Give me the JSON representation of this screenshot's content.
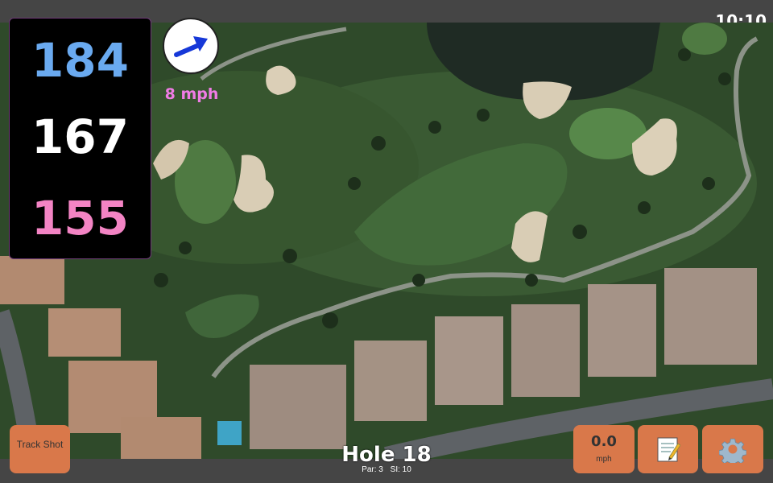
{
  "status": {
    "time": "10:10"
  },
  "distances": {
    "back": "184",
    "middle": "167",
    "front": "155",
    "colors": {
      "back": "#6aaaf0",
      "middle": "#ffffff",
      "front": "#f384c4"
    }
  },
  "wind": {
    "arrow_icon": "wind-direction-arrow-icon",
    "speed_label": "8 mph",
    "speed_color": "#f07ce6"
  },
  "buttons": {
    "track_shot": "Track Shot",
    "wind_value": "0.0",
    "wind_unit": "mph",
    "notes_icon": "notepad-icon",
    "settings_icon": "gear-icon",
    "accent": "#d9784a"
  },
  "hole": {
    "title": "Hole 18",
    "par": "Par: 3",
    "si": "SI: 10"
  }
}
